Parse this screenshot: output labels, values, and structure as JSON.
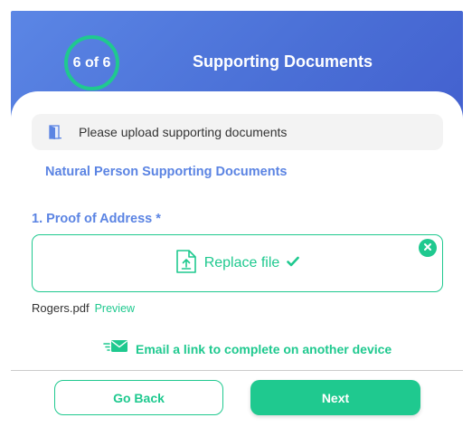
{
  "header": {
    "step_indicator": "6 of 6",
    "title": "Supporting Documents"
  },
  "notice": {
    "icon": "door-icon",
    "text": "Please upload supporting documents"
  },
  "section": {
    "title": "Natural Person Supporting Documents"
  },
  "field": {
    "label": "1. Proof of Address *",
    "upload_label": "Replace file",
    "upload_icon": "file-upload-icon",
    "status_icon": "checkmark-icon",
    "remove_icon": "close-icon",
    "file_name": "Rogers.pdf",
    "preview_label": "Preview"
  },
  "email_link": {
    "icon": "email-fast-icon",
    "label": "Email a link to complete on another device"
  },
  "footer": {
    "back_label": "Go Back",
    "next_label": "Next"
  },
  "colors": {
    "accent": "#1fc98f",
    "header_gradient_start": "#5b86e5",
    "header_gradient_end": "#4360cf",
    "section_text": "#5b84e3",
    "notice_bg": "#f3f3f3"
  }
}
